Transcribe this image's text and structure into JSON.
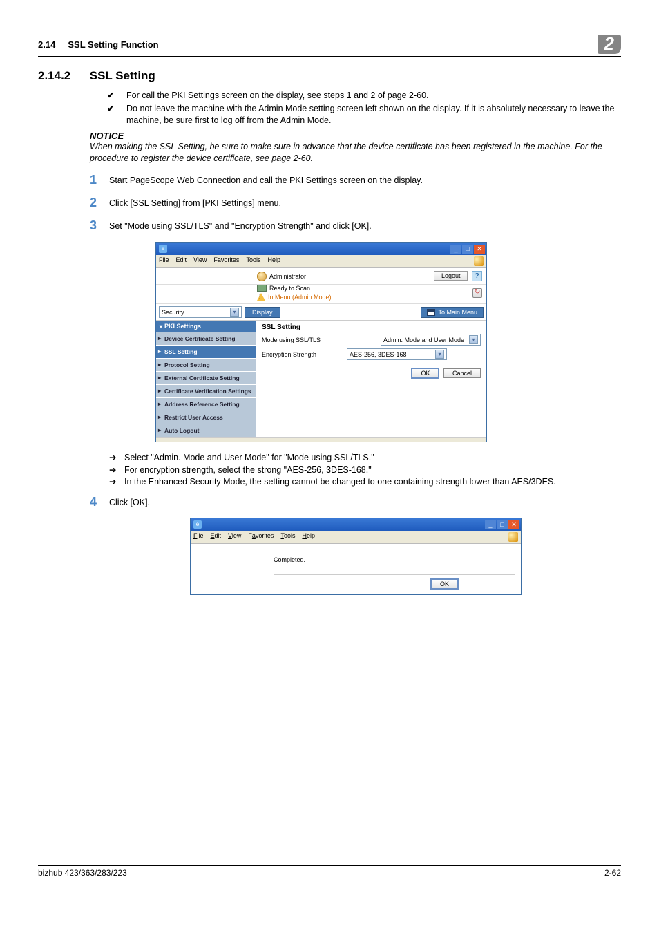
{
  "header": {
    "section_num": "2.14",
    "section_title": "SSL Setting Function",
    "chapter_badge": "2"
  },
  "title": {
    "number": "2.14.2",
    "text": "SSL Setting"
  },
  "intro_bullets": [
    "For call the PKI Settings screen on the display, see steps 1 and 2 of page 2-60.",
    "Do not leave the machine with the Admin Mode setting screen left shown on the display. If it is absolutely necessary to leave the machine, be sure first to log off from the Admin Mode."
  ],
  "notice": {
    "title": "NOTICE",
    "body": "When making the SSL Setting, be sure to make sure in advance that the device certificate has been registered in the machine. For the procedure to register the device certificate, see page 2-60."
  },
  "steps": [
    "Start PageScope Web Connection and call the PKI Settings screen on the display.",
    "Click [SSL Setting] from [PKI Settings] menu.",
    "Set \"Mode using SSL/TLS\" and \"Encryption Strength\" and click [OK]."
  ],
  "screenshot1": {
    "menubar": {
      "file": "File",
      "edit": "Edit",
      "view": "View",
      "favorites": "Favorites",
      "tools": "Tools",
      "help": "Help"
    },
    "app": {
      "role": "Administrator",
      "logout": "Logout",
      "help": "?"
    },
    "status": {
      "ready": "Ready to Scan",
      "menu": "In Menu (Admin Mode)"
    },
    "nav": {
      "category": "Security",
      "display": "Display",
      "tomain": "To Main Menu"
    },
    "sidebar": {
      "head": "PKI Settings",
      "items": [
        "Device Certificate Setting",
        "SSL Setting",
        "Protocol Setting",
        "External Certificate Setting",
        "Certificate Verification Settings",
        "Address Reference Setting",
        "Restrict User Access",
        "Auto Logout"
      ]
    },
    "content": {
      "title": "SSL Setting",
      "row1_label": "Mode using SSL/TLS",
      "row1_value": "Admin. Mode and User Mode",
      "row2_label": "Encryption Strength",
      "row2_value": "AES-256, 3DES-168",
      "ok": "OK",
      "cancel": "Cancel"
    }
  },
  "sub_bullets": [
    "Select \"Admin. Mode and User Mode\" for \"Mode using SSL/TLS.\"",
    "For encryption strength, select the strong \"AES-256, 3DES-168.\"",
    "In the Enhanced Security Mode, the setting cannot be changed to one containing strength lower than AES/3DES."
  ],
  "step4": "Click [OK].",
  "screenshot2": {
    "menubar": {
      "file": "File",
      "edit": "Edit",
      "view": "View",
      "favorites": "Favorites",
      "tools": "Tools",
      "help": "Help"
    },
    "completed": "Completed.",
    "ok": "OK"
  },
  "footer": {
    "left": "bizhub 423/363/283/223",
    "right": "2-62"
  }
}
